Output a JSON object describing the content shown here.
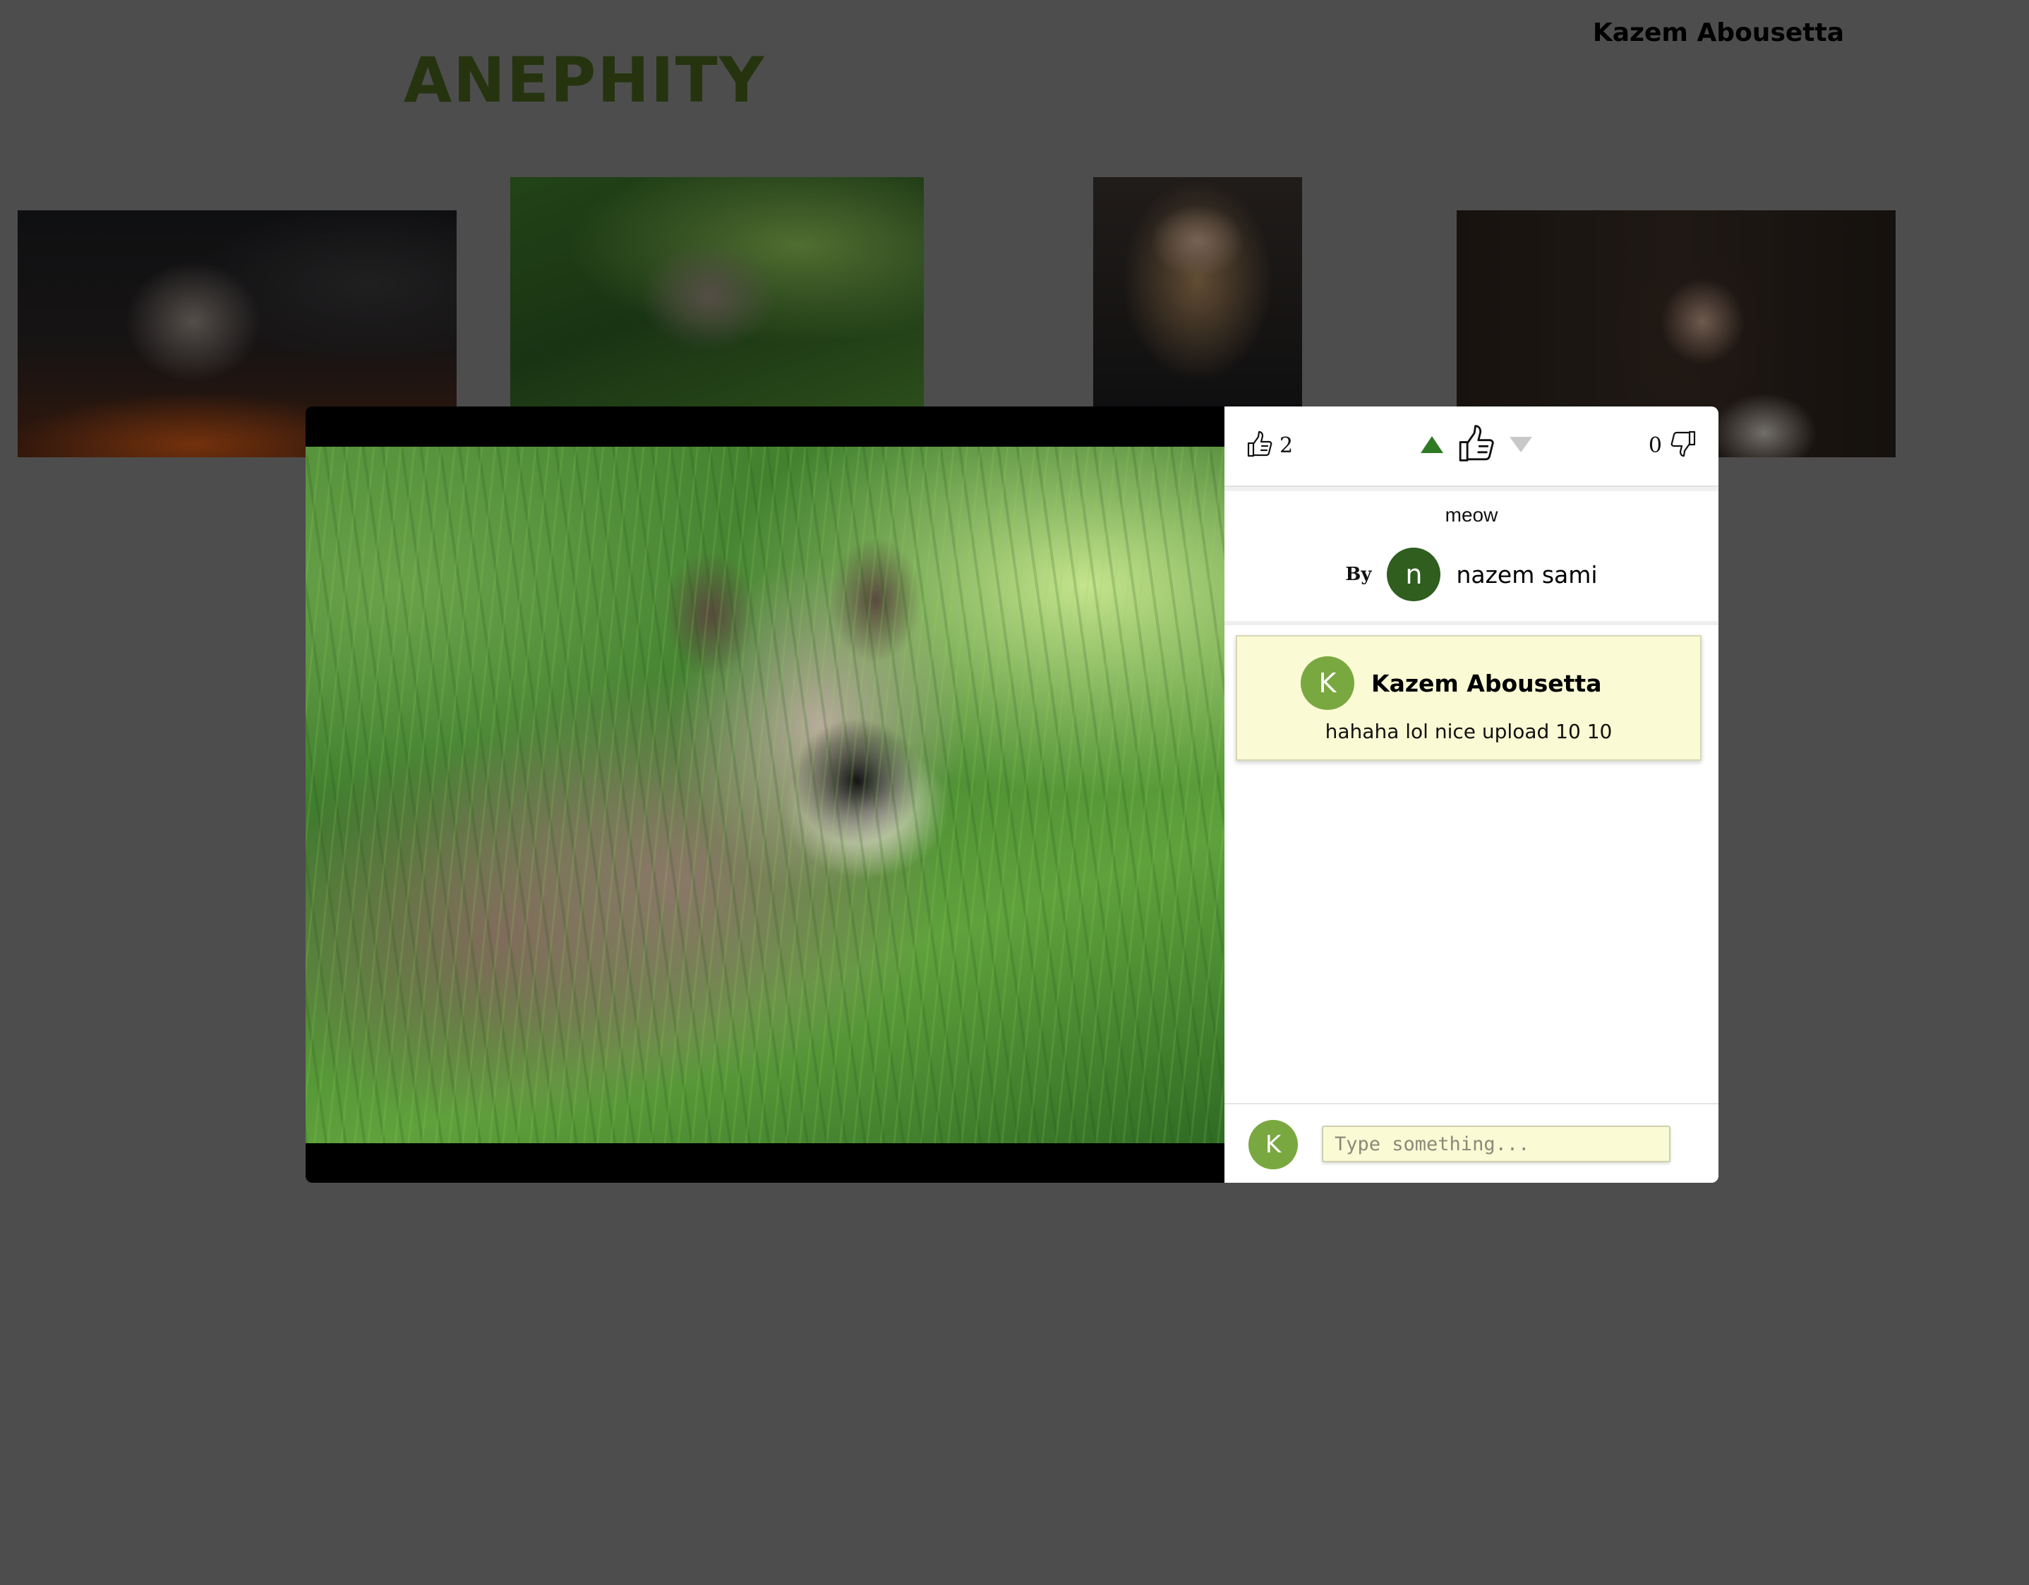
{
  "header": {
    "brand": "ANEPHITY",
    "current_user": "Kazem Abousetta"
  },
  "gallery": {
    "thumbnails": [
      {
        "name": "armored-knight-image"
      },
      {
        "name": "raccoon-image"
      },
      {
        "name": "blonde-woman-image"
      },
      {
        "name": "dark-haired-woman-image"
      }
    ]
  },
  "modal": {
    "photo_icon": "raccoon-photo",
    "votes": {
      "likes": "2",
      "dislikes": "0",
      "upvote_color": "#2f7a25",
      "downvote_color": "#c8c8c8"
    },
    "post": {
      "caption": "meow",
      "by_label": "By",
      "author_initial": "n",
      "author_name": "nazem sami"
    },
    "comments": [
      {
        "initial": "K",
        "author": "Kazem Abousetta",
        "text": "hahaha lol nice upload 10 10"
      }
    ],
    "composer": {
      "initial": "K",
      "placeholder": "Type something...",
      "value": ""
    }
  },
  "colors": {
    "background": "#4d4d4d",
    "brand": "#25340f",
    "comment_card": "#fafad4",
    "avatar_green": "#7aa840",
    "author_avatar": "#2f5e1f"
  }
}
